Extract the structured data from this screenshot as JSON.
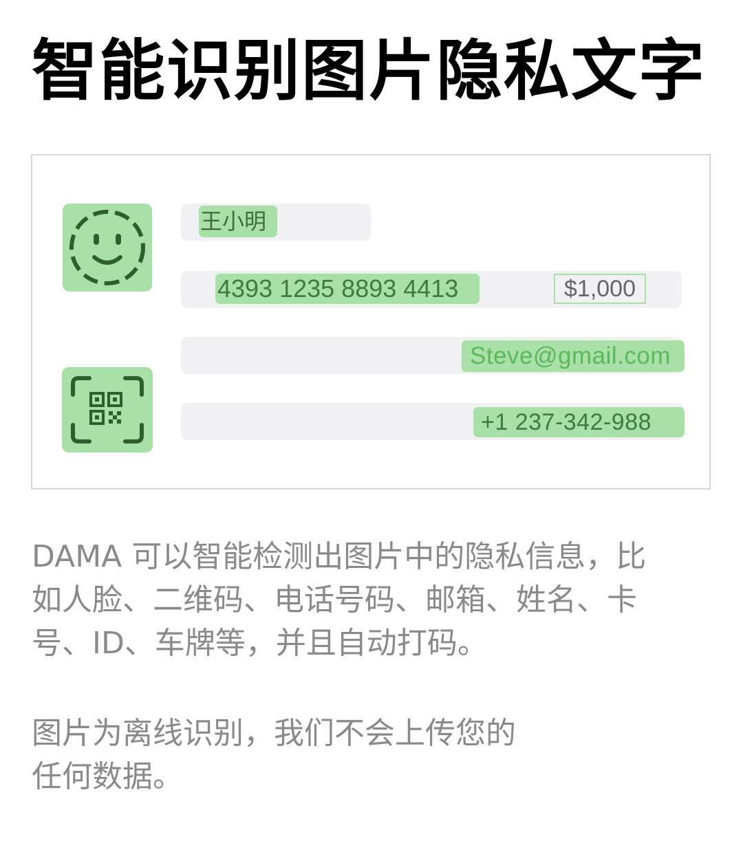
{
  "title": "智能识别图片隐私文字",
  "illustration": {
    "name_text": "王小明",
    "card_number": "4393 1235 8893 4413",
    "amount": "$1,000",
    "email": "Steve@gmail.com",
    "phone": "+1 237-342-988",
    "icons": [
      "face-id-icon",
      "qr-code-scan-icon"
    ],
    "colors": {
      "highlight": "#a8e0a8",
      "icon_stroke": "#2e5e2e",
      "bar": "#f1f1f4"
    }
  },
  "description": {
    "line1": "DAMA 可以智能检测出图片中的隐私信息，比",
    "line2": "如人脸、二维码、电话号码、邮箱、姓名、卡",
    "line3": "号、ID、车牌等，并且自动打码。",
    "line4": "图片为离线识别，我们不会上传您的",
    "line5": "任何数据。"
  }
}
